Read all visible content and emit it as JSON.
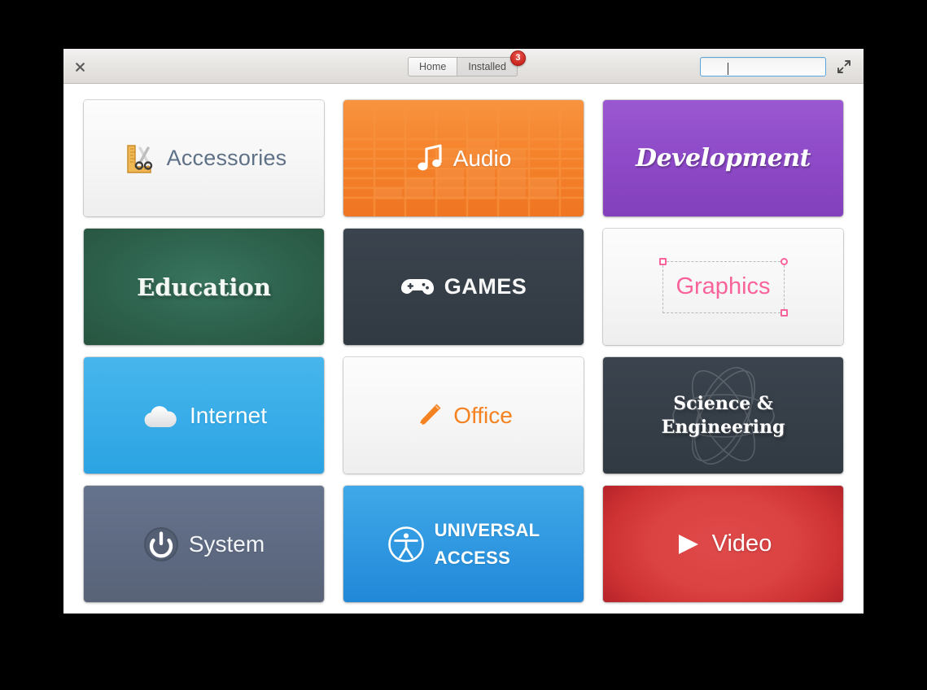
{
  "window": {
    "close_label": "✕"
  },
  "header": {
    "tabs": [
      {
        "label": "Home",
        "active": false
      },
      {
        "label": "Installed",
        "active": true,
        "badge": "3"
      }
    ],
    "search": {
      "value": "",
      "placeholder": "",
      "icon": "search-icon"
    },
    "expand_icon": "expand-fullscreen-icon"
  },
  "categories": [
    {
      "id": "accessories",
      "label": "Accessories",
      "icon": "ruler-scissors-icon",
      "color": "#f7f7f7"
    },
    {
      "id": "audio",
      "label": "Audio",
      "icon": "music-note-icon",
      "color": "#f5832c"
    },
    {
      "id": "development",
      "label": "Development",
      "icon": "none",
      "color": "#8e4ac8"
    },
    {
      "id": "education",
      "label": "Education",
      "icon": "none",
      "color": "#2f6550"
    },
    {
      "id": "games",
      "label": "GAMES",
      "icon": "gamepad-icon",
      "color": "#353d47"
    },
    {
      "id": "graphics",
      "label": "Graphics",
      "icon": "selection-handles-icon",
      "color": "#f7f7f7"
    },
    {
      "id": "internet",
      "label": "Internet",
      "icon": "cloud-icon",
      "color": "#39ade8"
    },
    {
      "id": "office",
      "label": "Office",
      "icon": "pencil-icon",
      "color": "#f7f7f7"
    },
    {
      "id": "science",
      "label": "Science &\nEngineering",
      "icon": "atom-icon",
      "color": "#353d47"
    },
    {
      "id": "system",
      "label": "System",
      "icon": "power-icon",
      "color": "#5e6a82"
    },
    {
      "id": "universal",
      "label": "UNIVERSAL\nACCESS",
      "icon": "accessibility-icon",
      "color": "#2f97e0"
    },
    {
      "id": "video",
      "label": "Video",
      "icon": "play-icon",
      "color": "#cf3333"
    }
  ]
}
